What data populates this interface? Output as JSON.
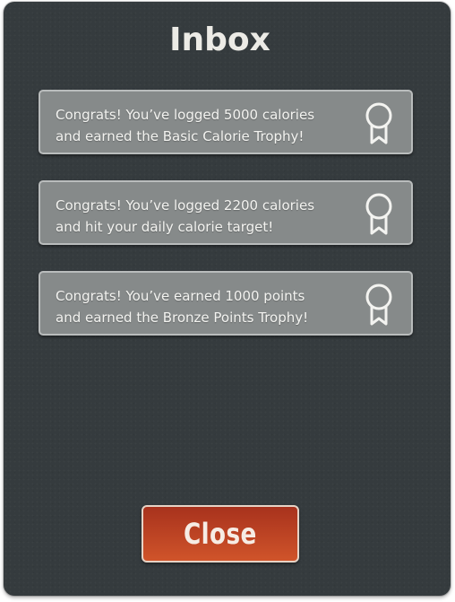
{
  "dialog": {
    "title": "Inbox",
    "close_label": "Close",
    "messages": [
      {
        "text": "Congrats! You’ve logged 5000 calories\nand earned the Basic Calorie Trophy!",
        "icon": "award-ribbon-icon"
      },
      {
        "text": "Congrats! You’ve logged 2200 calories\nand hit your daily calorie target!",
        "icon": "award-ribbon-icon"
      },
      {
        "text": "Congrats! You’ve earned 1000 points\nand earned the Bronze Points Trophy!",
        "icon": "award-ribbon-icon"
      }
    ]
  },
  "colors": {
    "panel_bg": "#353b3e",
    "card_bg": "#868a8a",
    "card_border": "#b9bcbc",
    "button_top": "#a8321d",
    "button_bottom": "#d0542a",
    "text_light": "#ecebe6"
  }
}
